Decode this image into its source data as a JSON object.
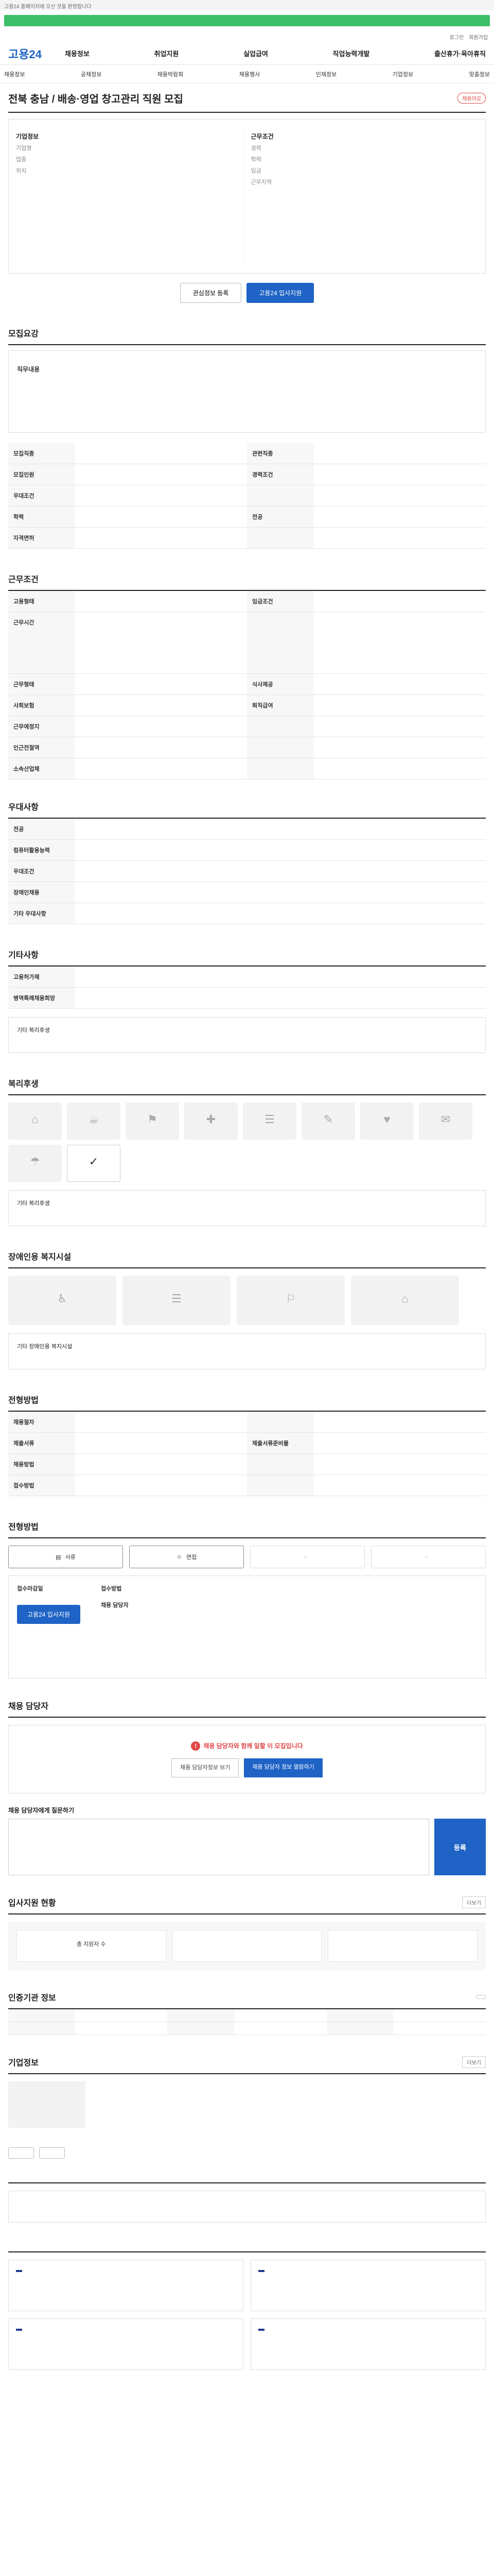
{
  "notice": "고용24 홈페이지에 오신 것을 환영합니다",
  "top_links": [
    "로그인",
    "회원가입"
  ],
  "logo": "고용24",
  "gnb": [
    "채용정보",
    "취업지원",
    "실업급여",
    "직업능력개발",
    "출산휴가·육아휴직"
  ],
  "subnav": [
    "채용정보",
    "공채정보",
    "채용박람회",
    "채용행사",
    "인재정보",
    "기업정보",
    "맞춤정보"
  ],
  "job": {
    "title": "전북 충남 / 배송·영업 창고관리 직원 모집",
    "badge": "채용마감",
    "company_head": "기업정보",
    "company_rows": [
      {
        "k": "기업명",
        "v": ""
      },
      {
        "k": "업종",
        "v": ""
      },
      {
        "k": "위치",
        "v": ""
      }
    ],
    "work_head": "근무조건",
    "work_rows": [
      {
        "k": "경력",
        "v": ""
      },
      {
        "k": "학력",
        "v": ""
      },
      {
        "k": "임금",
        "v": ""
      },
      {
        "k": "근무지역",
        "v": ""
      }
    ],
    "save_label": "관심정보 등록",
    "apply_label": "고용24 입사지원",
    "button_note": ""
  },
  "summary": {
    "title": "모집요강",
    "head": "직무내용",
    "body": ""
  },
  "recruit": {
    "rows": [
      {
        "k": "모집직종",
        "v": "",
        "k2": "관련직종",
        "v2": ""
      },
      {
        "k": "모집인원",
        "v": "",
        "k2": "경력조건",
        "v2": ""
      },
      {
        "k": "우대조건",
        "v": "",
        "k2": "",
        "v2": ""
      },
      {
        "k": "학력",
        "v": "",
        "k2": "전공",
        "v2": ""
      },
      {
        "k": "자격면허",
        "v": "",
        "k2": "",
        "v2": ""
      }
    ]
  },
  "conditions": {
    "title": "근무조건",
    "rows": [
      {
        "k": "고용형태",
        "v": "",
        "k2": "임금조건",
        "v2": ""
      },
      {
        "k": "근무시간",
        "v": "",
        "k2": "",
        "v2": ""
      },
      {
        "k": "근무형태",
        "v": "",
        "k2": "식사제공",
        "v2": ""
      },
      {
        "k": "사회보험",
        "v": "",
        "k2": "퇴직급여",
        "v2": ""
      },
      {
        "k": "근무예정지",
        "v": "",
        "k2": "",
        "v2": ""
      },
      {
        "k": "인근전철역",
        "v": "",
        "k2": "",
        "v2": ""
      },
      {
        "k": "소속산업체",
        "v": "",
        "k2": "",
        "v2": ""
      }
    ],
    "note": ""
  },
  "pref": {
    "title": "우대사항",
    "rows": [
      {
        "k": "전공",
        "v": ""
      },
      {
        "k": "컴퓨터활용능력",
        "v": ""
      },
      {
        "k": "우대조건",
        "v": ""
      },
      {
        "k": "장애인채용",
        "v": ""
      },
      {
        "k": "기타 우대사항",
        "v": ""
      }
    ]
  },
  "etc": {
    "title": "기타사항",
    "rows": [
      {
        "k": "고용허가제",
        "v": ""
      },
      {
        "k": "병역특례채용희망",
        "v": ""
      }
    ],
    "toggle_label": "기타 복리후생"
  },
  "welfare": {
    "title": "복리후생",
    "items": [
      {
        "label": "",
        "icon": "⌂",
        "on": false
      },
      {
        "label": "",
        "icon": "☕",
        "on": false
      },
      {
        "label": "",
        "icon": "⚑",
        "on": false
      },
      {
        "label": "",
        "icon": "✚",
        "on": false
      },
      {
        "label": "",
        "icon": "☰",
        "on": false
      },
      {
        "label": "",
        "icon": "✎",
        "on": false
      },
      {
        "label": "",
        "icon": "♥",
        "on": false
      },
      {
        "label": "",
        "icon": "✉",
        "on": false
      },
      {
        "label": "",
        "icon": "☂",
        "on": false
      },
      {
        "label": "",
        "icon": "✓",
        "on": true
      }
    ],
    "extra_label": "기타 복리후생"
  },
  "disabled": {
    "title": "장애인용 복지시설",
    "items": [
      {
        "label": "",
        "icon": "♿"
      },
      {
        "label": "",
        "icon": "☰"
      },
      {
        "label": "",
        "icon": "⚐"
      },
      {
        "label": "",
        "icon": "⌂"
      }
    ],
    "extra_label": "기타 장애인용 복지시설"
  },
  "selection": {
    "title": "전형방법",
    "rows": [
      {
        "k": "채용절차",
        "v": "",
        "k2": "",
        "v2": ""
      },
      {
        "k": "제출서류",
        "v": "",
        "k2": "제출서류준비물",
        "v2": ""
      },
      {
        "k": "채용방법",
        "v": "",
        "k2": "",
        "v2": ""
      },
      {
        "k": "접수방법",
        "v": "",
        "k2": "",
        "v2": ""
      }
    ]
  },
  "process": {
    "title": "전형방법",
    "steps": [
      {
        "label": "서류",
        "on": true
      },
      {
        "label": "면접",
        "on": true
      },
      {
        "label": "",
        "on": false
      },
      {
        "label": "",
        "on": false
      }
    ]
  },
  "apply": {
    "period_label": "접수마감일",
    "period_value": "",
    "method_label": "접수방법",
    "method_value": "",
    "contact_label": "채용 담당자",
    "contact_value": "",
    "button": "고용24 입사지원",
    "notes": ""
  },
  "manager": {
    "title": "채용 담당자",
    "warn": "채용 담당자와 함께 일할 이 모집입니다",
    "body": "",
    "btn_a": "채용 담당자정보 보기",
    "btn_b": "채용 담당자 정보 열람하기",
    "ask_title": "채용 담당자에게 질문하기",
    "ask_count": "",
    "ask_placeholder": "",
    "send": "등록",
    "check_notes": ""
  },
  "stats": {
    "title": "입사지원 현황",
    "more": "더보기",
    "items": [
      {
        "t": "총 지원자 수",
        "n": ""
      },
      {
        "t": "",
        "n": ""
      },
      {
        "t": "",
        "n": ""
      }
    ]
  },
  "agency": {
    "title": "인증기관 정보",
    "more": "",
    "rows": [
      {
        "k": "",
        "v": "",
        "k2": "",
        "v2": "",
        "k3": "",
        "v3": ""
      },
      {
        "k": "",
        "v": "",
        "k2": "",
        "v2": "",
        "k3": "",
        "v3": ""
      }
    ],
    "note": ""
  },
  "company": {
    "title": "기업정보",
    "more": "더보기",
    "logo_ph": "",
    "rows": [
      {
        "k": "",
        "v": "",
        "k2": "",
        "v2": ""
      },
      {
        "k": "",
        "v": "",
        "k2": "",
        "v2": ""
      },
      {
        "k": "",
        "v": "",
        "k2": "",
        "v2": ""
      },
      {
        "k": "",
        "v": "",
        "k2": "",
        "v2": ""
      }
    ],
    "buttons": [
      "",
      ""
    ]
  },
  "other_jobs": {
    "title": "",
    "empty": ""
  },
  "recommend": {
    "title": "",
    "cards": [
      {
        "badge": "",
        "title": "",
        "meta1": "",
        "meta2": ""
      },
      {
        "badge": "",
        "title": "",
        "meta1": "",
        "meta2": ""
      },
      {
        "badge": "",
        "title": "",
        "meta1": "",
        "meta2": ""
      },
      {
        "badge": "",
        "title": "",
        "meta1": "",
        "meta2": ""
      }
    ]
  },
  "colors": {
    "brand": "#1e63c5",
    "banner": "#3dbe6a",
    "alert": "#e04848"
  }
}
